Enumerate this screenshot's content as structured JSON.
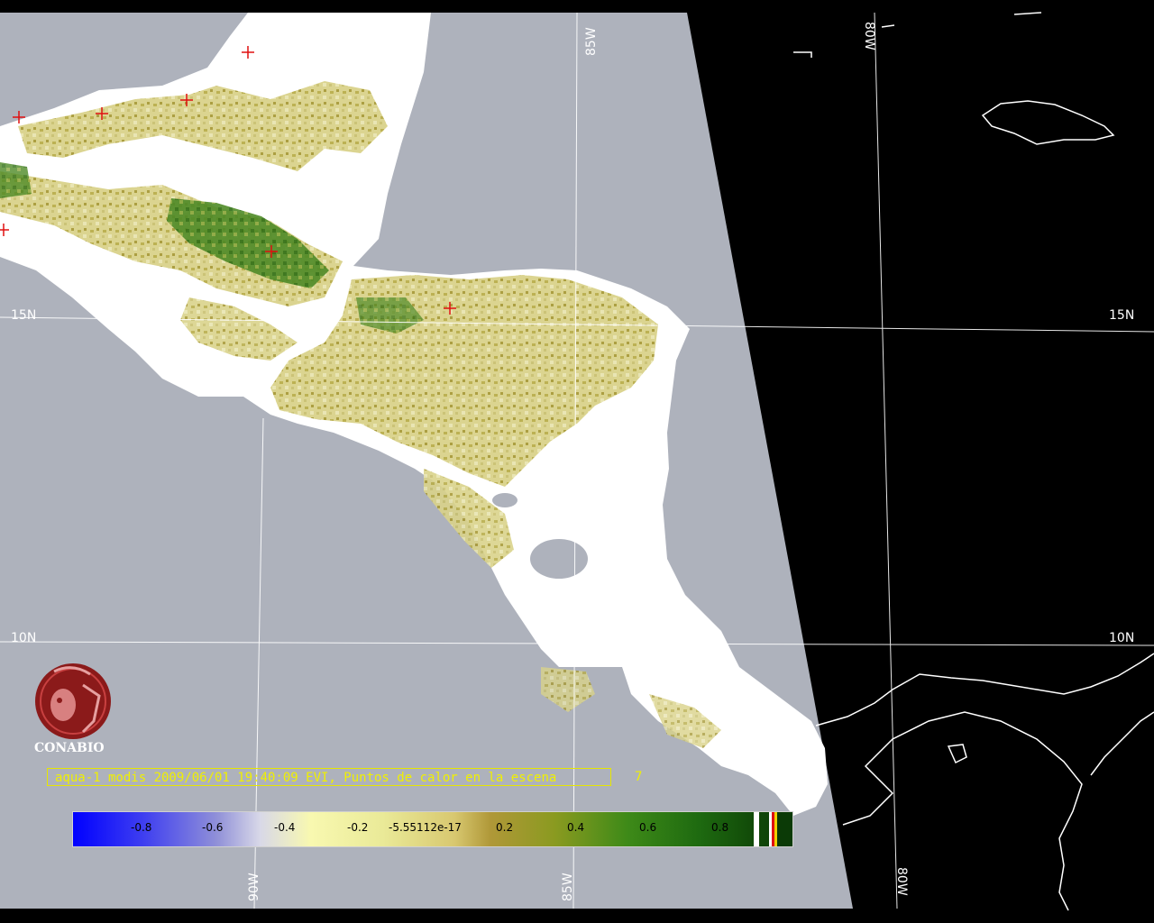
{
  "grid_labels": {
    "lat_15_left": "15N",
    "lat_15_right": "15N",
    "lat_10_left": "10N",
    "lat_10_right": "10N",
    "lon_85_top": "85W",
    "lon_80_top": "80W",
    "lon_90_bottom": "90W",
    "lon_85_bottom": "85W",
    "lon_80_bottom": "80W"
  },
  "logo": {
    "name": "CONABIO"
  },
  "caption": {
    "text": "aqua-1 modis 2009/06/01 19:40:09 EVI, Puntos de calor en la escena",
    "count": "7"
  },
  "colorbar": {
    "ticks": [
      "-0.8",
      "-0.6",
      "-0.4",
      "-0.2",
      "-5.55112e-17",
      "0.2",
      "0.4",
      "0.6",
      "0.8"
    ]
  },
  "hotspots_count": 7,
  "colors": {
    "ocean": "#aeb2bc",
    "outside_swath": "#000000",
    "cloud": "#ffffff",
    "grid": "#ffffff",
    "hotspot": "#e01010",
    "caption": "#f0f000",
    "logo": "#8b1a1a"
  }
}
